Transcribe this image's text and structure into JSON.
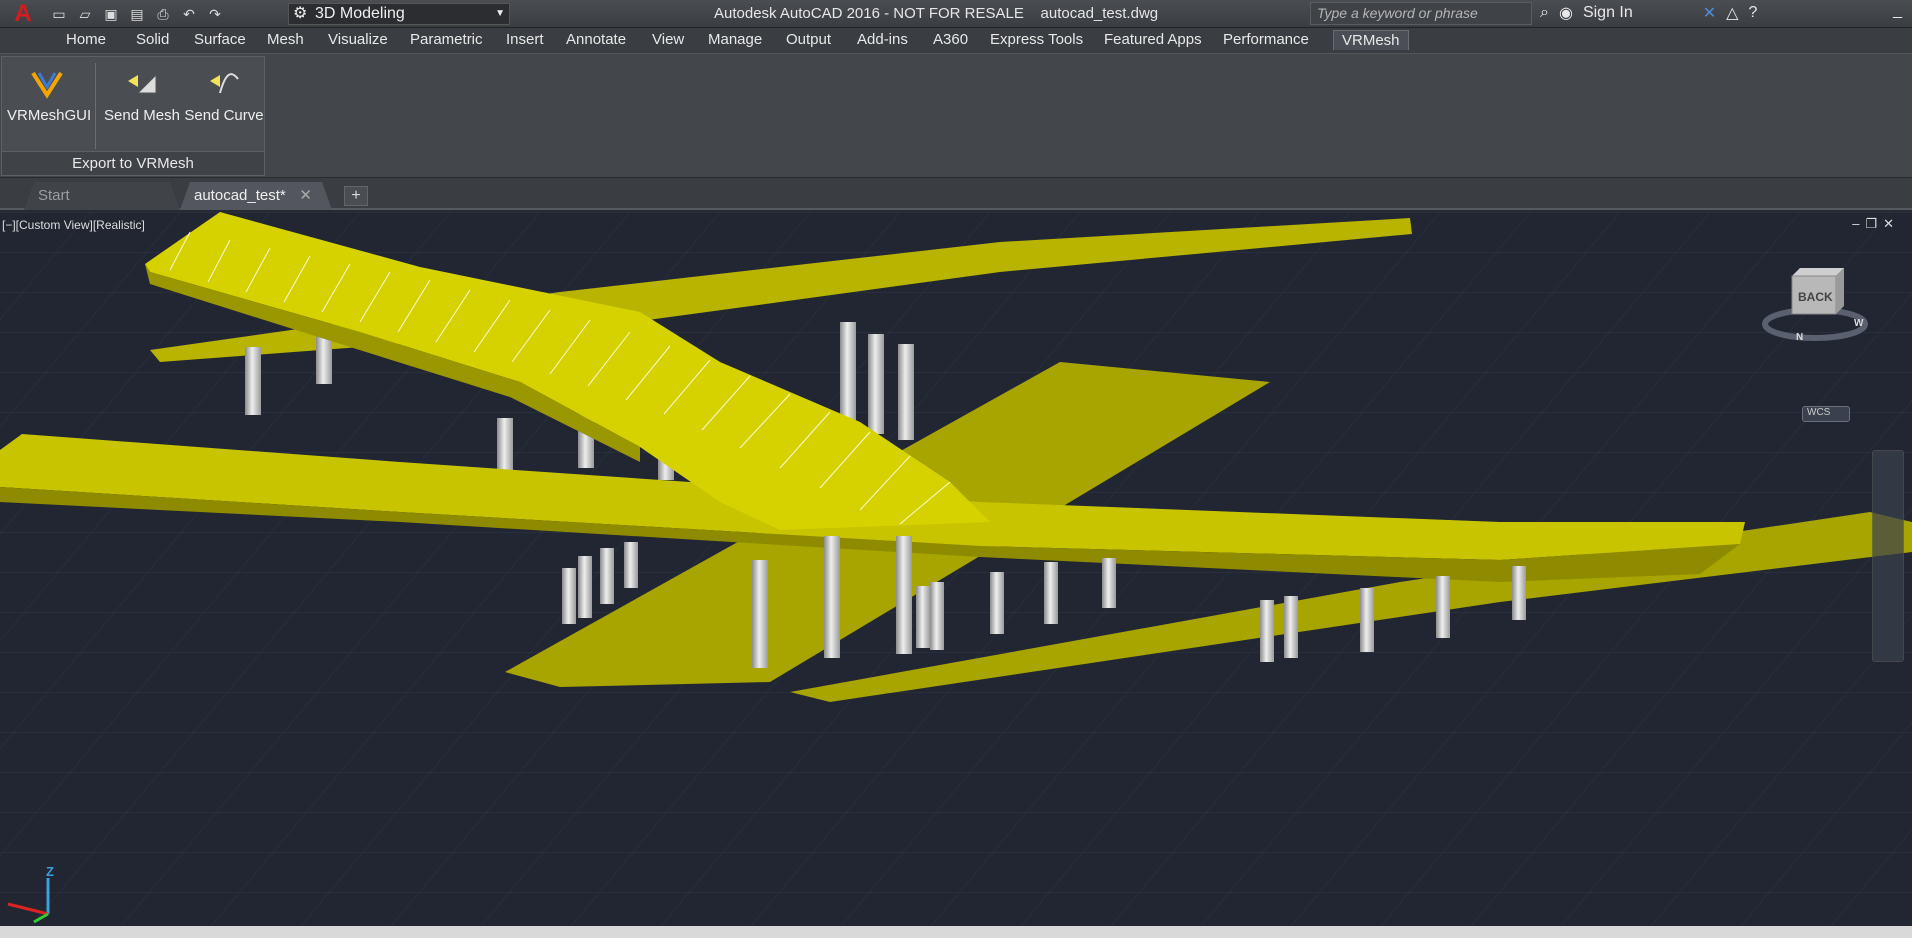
{
  "titlebar": {
    "workspace": "3D Modeling",
    "title": "Autodesk AutoCAD 2016 - NOT FOR RESALE",
    "filename": "autocad_test.dwg",
    "search_placeholder": "Type a keyword or phrase",
    "sign_in": "Sign In"
  },
  "ribbon_tabs": [
    "Home",
    "Solid",
    "Surface",
    "Mesh",
    "Visualize",
    "Parametric",
    "Insert",
    "Annotate",
    "View",
    "Manage",
    "Output",
    "Add-ins",
    "A360",
    "Express Tools",
    "Featured Apps",
    "Performance",
    "VRMesh"
  ],
  "ribbon": {
    "buttons": [
      "VRMeshGUI",
      "Send Mesh",
      "Send Curve"
    ],
    "panel_title": "Export to VRMesh"
  },
  "doc_tabs": {
    "start": "Start",
    "current": "autocad_test*"
  },
  "viewport": {
    "label": "[−][Custom View][Realistic]",
    "viewcube_face": "BACK",
    "compass_n": "N",
    "compass_w": "W",
    "wcs": "WCS",
    "axis_z": "Z"
  },
  "colors": {
    "model": "#c9c400",
    "model_dark": "#9a9600",
    "pillar": "#c8c8c8",
    "viewport_bg": "#212632"
  }
}
